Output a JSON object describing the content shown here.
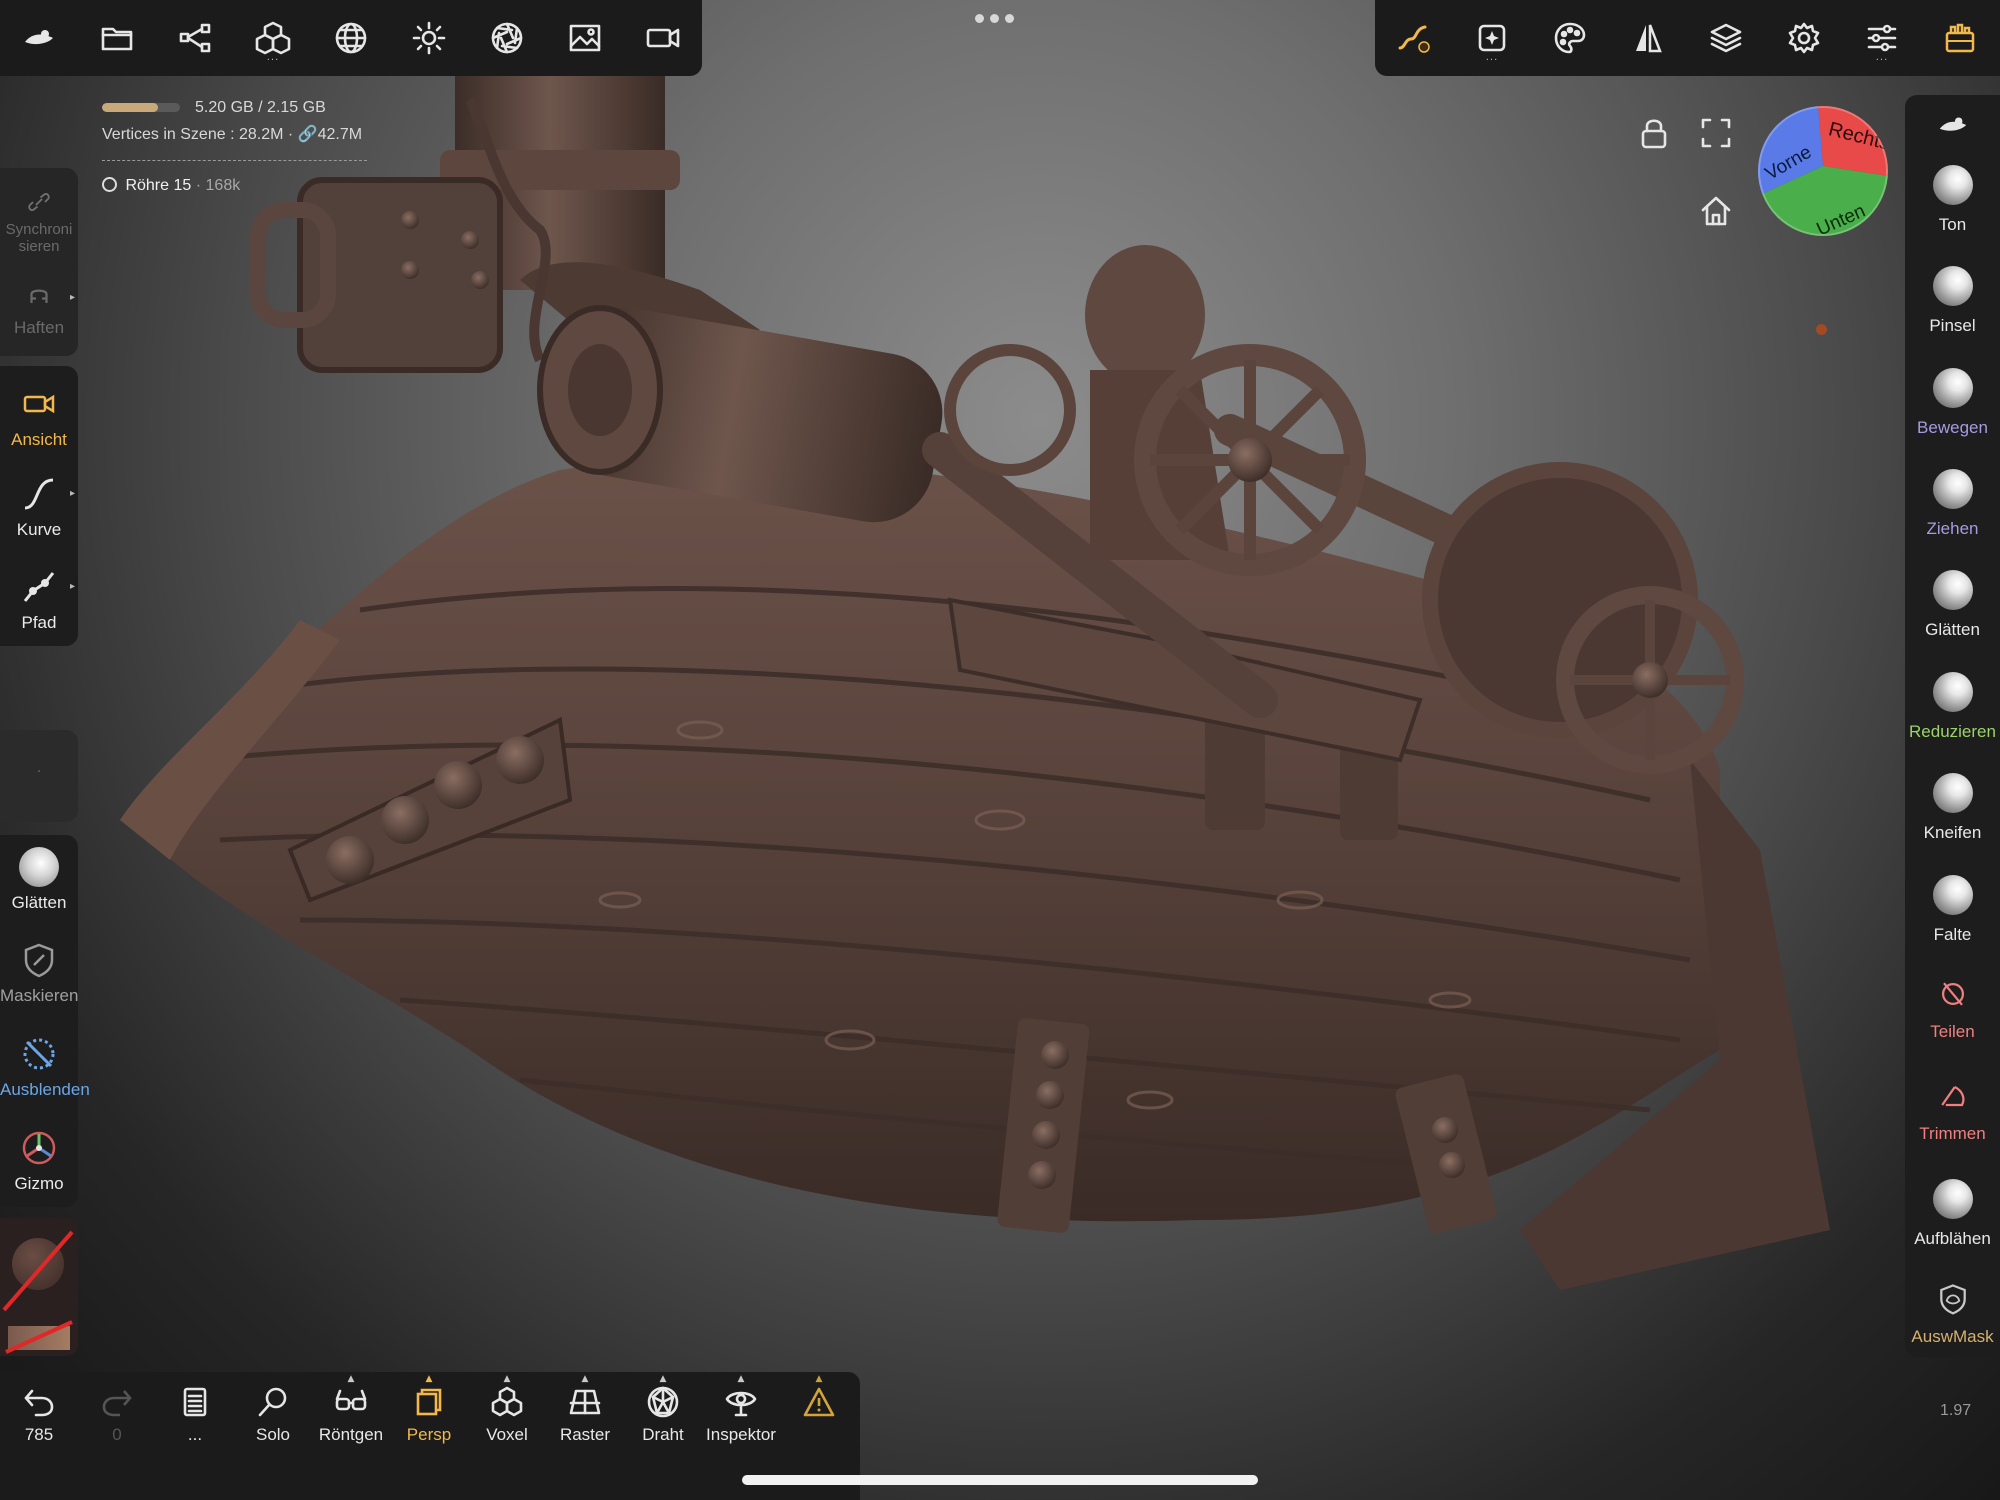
{
  "top_toolbar_left": {
    "items": [
      "logo-icon",
      "folder-icon",
      "share-icon",
      "scene-icon",
      "grid-sphere-icon",
      "sun-icon",
      "aperture-icon",
      "image-icon",
      "camera-icon"
    ]
  },
  "top_toolbar_right": {
    "items": [
      "stroke-icon",
      "sparkle-icon",
      "palette-icon",
      "symmetry-icon",
      "layers-icon",
      "gear-icon",
      "sliders-icon",
      "tool-case-icon"
    ]
  },
  "info": {
    "memory": "5.20 GB / 2.15 GB",
    "memory_fill": 0.72,
    "vertices_label": "Vertices in Szene :",
    "vertices_value": "28.2M",
    "vertices_linked": "42.7M",
    "selected_object": "Röhre 15",
    "selected_count": "168k"
  },
  "left_sidebar": {
    "sync": "Synchroni sieren",
    "haften": "Haften",
    "ansicht": "Ansicht",
    "kurve": "Kurve",
    "pfad": "Pfad",
    "placeholder": "·",
    "glaetten": "Glätten",
    "maskieren": "Maskieren",
    "ausblenden": "Ausblenden",
    "gizmo": "Gizmo"
  },
  "right_sidebar": {
    "tools": [
      {
        "label": "Ton",
        "color": "#e8e8e8"
      },
      {
        "label": "Pinsel",
        "color": "#e8e8e8"
      },
      {
        "label": "Bewegen",
        "color": "#a79ae0"
      },
      {
        "label": "Ziehen",
        "color": "#a79ae0"
      },
      {
        "label": "Glätten",
        "color": "#e8e8e8"
      },
      {
        "label": "Reduzieren",
        "color": "#9ad468"
      },
      {
        "label": "Kneifen",
        "color": "#e8e8e8"
      },
      {
        "label": "Falte",
        "color": "#e8e8e8"
      },
      {
        "label": "Teilen",
        "color": "#f08080"
      },
      {
        "label": "Trimmen",
        "color": "#f08080"
      },
      {
        "label": "Aufblähen",
        "color": "#e8e8e8"
      },
      {
        "label": "AuswMask",
        "color": "#d6b070"
      }
    ]
  },
  "nav_cube": {
    "right": "Rechts",
    "front": "Vorne",
    "bottom": "Unten"
  },
  "bottom_toolbar": {
    "undo_count": "785",
    "redo_count": "0",
    "more": "...",
    "solo": "Solo",
    "roentgen": "Röntgen",
    "persp": "Persp",
    "voxel": "Voxel",
    "raster": "Raster",
    "draht": "Draht",
    "inspektor": "Inspektor"
  },
  "version": "1.97",
  "colors": {
    "accent": "#f2b84b",
    "toolbar_bg": "#1b1b1b",
    "model_brown": "#5a443c"
  }
}
